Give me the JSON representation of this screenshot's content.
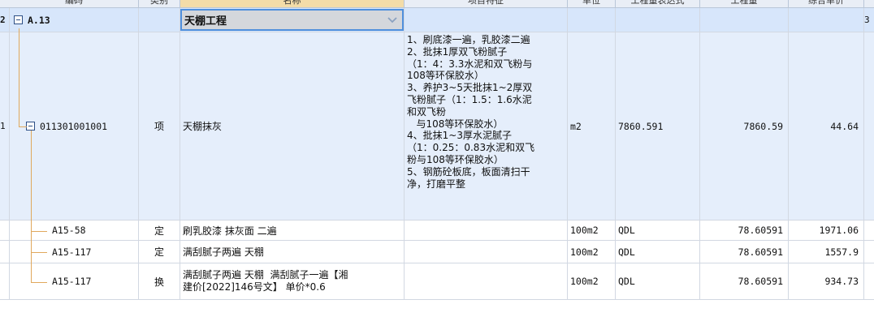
{
  "header": {
    "cols": [
      "编码",
      "类别",
      "名称",
      "项目特征",
      "单位",
      "工程量表达式",
      "工程量",
      "综合单价"
    ]
  },
  "rows": [
    {
      "rownum": "2",
      "code": "A.13",
      "type": "",
      "name": "天棚工程",
      "feature": "",
      "unit": "",
      "expr": "",
      "qty": "",
      "price": "",
      "extra": "3"
    },
    {
      "rownum": "1",
      "code": "011301001001",
      "type": "项",
      "name": "天棚抹灰",
      "feature": "1、刷底漆一遍，乳胶漆二遍\n2、批抹1厚双飞粉腻子\n（1：4：3.3水泥和双飞粉与\n108等环保胶水）\n3、养护3~5天批抹1~2厚双\n飞粉腻子（1：1.5：1.6水泥\n和双飞粉\n   与108等环保胶水）\n4、批抹1~3厚水泥腻子\n（1：0.25：0.83水泥和双飞\n粉与108等环保胶水）\n5、钢筋砼板底，板面清扫干\n净，打磨平整",
      "unit": "m2",
      "expr": "7860.591",
      "qty": "7860.59",
      "price": "44.64"
    },
    {
      "code": "A15-58",
      "type": "定",
      "name": "刷乳胶漆 抹灰面 二遍",
      "unit": "100m2",
      "expr": "QDL",
      "qty": "78.60591",
      "price": "1971.06"
    },
    {
      "code": "A15-117",
      "type": "定",
      "name": "满刮腻子两遍 天棚",
      "unit": "100m2",
      "expr": "QDL",
      "qty": "78.60591",
      "price": "1557.9"
    },
    {
      "code": "A15-117",
      "type": "换",
      "name": "满刮腻子两遍 天棚  满刮腻子一遍【湘\n建价[2022]146号文】 单价*0.6",
      "unit": "100m2",
      "expr": "QDL",
      "qty": "78.60591",
      "price": "934.73"
    }
  ],
  "colors": {
    "selected_row": "#d7e6fb",
    "active_row": "#e5eefb",
    "tree_line": "#e0a85c",
    "focus_border": "#4f8fdc"
  },
  "icons": {
    "collapse": "minus-box-icon",
    "dropdown": "chevron-down-icon"
  }
}
